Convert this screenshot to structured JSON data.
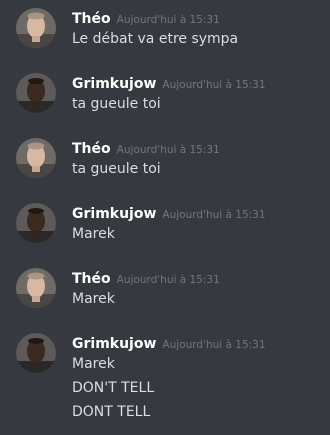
{
  "messages": [
    {
      "author": "Théo",
      "avatar_icon": "theo-avatar",
      "timestamp": "Aujourd'hui à 15:31",
      "lines": [
        "Le débat va etre sympa"
      ]
    },
    {
      "author": "Grimkujow",
      "avatar_icon": "grimkujow-avatar",
      "timestamp": "Aujourd'hui à 15:31",
      "lines": [
        "ta gueule toi"
      ]
    },
    {
      "author": "Théo",
      "avatar_icon": "theo-avatar",
      "timestamp": "Aujourd'hui à 15:31",
      "lines": [
        "ta gueule toi"
      ]
    },
    {
      "author": "Grimkujow",
      "avatar_icon": "grimkujow-avatar",
      "timestamp": "Aujourd'hui à 15:31",
      "lines": [
        "Marek"
      ]
    },
    {
      "author": "Théo",
      "avatar_icon": "theo-avatar",
      "timestamp": "Aujourd'hui à 15:31",
      "lines": [
        "Marek"
      ]
    },
    {
      "author": "Grimkujow",
      "avatar_icon": "grimkujow-avatar",
      "timestamp": "Aujourd'hui à 15:31",
      "lines": [
        "Marek",
        "DON'T TELL",
        "DONT TELL"
      ]
    }
  ],
  "colors": {
    "background": "#36393f",
    "username": "#ffffff",
    "timestamp": "#72767d",
    "message_text": "#dcddde"
  }
}
